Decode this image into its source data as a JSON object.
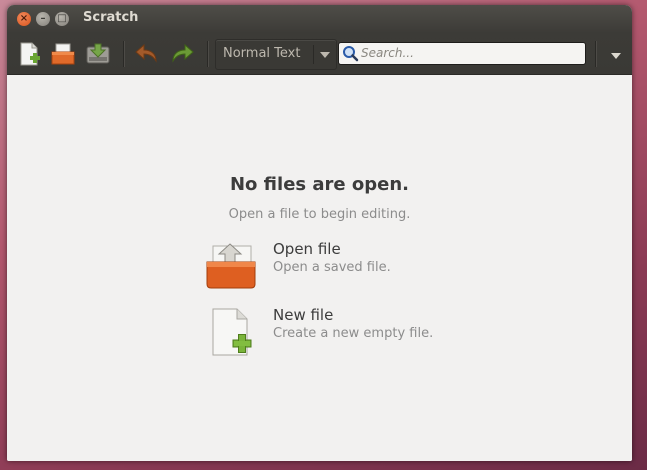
{
  "window": {
    "title": "Scratch",
    "controls": [
      "close",
      "minimize",
      "maximize"
    ]
  },
  "toolbar": {
    "buttons": [
      {
        "icon": "new-document-icon"
      },
      {
        "icon": "open-folder-icon"
      },
      {
        "icon": "save-icon"
      },
      {
        "icon": "undo-icon"
      },
      {
        "icon": "redo-icon"
      }
    ],
    "language_combo": {
      "value": "Normal Text"
    },
    "search": {
      "placeholder": "Search..."
    },
    "menu": {
      "icon": "menu-arrow-icon"
    }
  },
  "welcome": {
    "heading": "No files are open.",
    "subheading": "Open a file to begin editing.",
    "actions": [
      {
        "icon": "open-folder-icon",
        "title": "Open file",
        "description": "Open a saved file."
      },
      {
        "icon": "new-file-icon",
        "title": "New file",
        "description": "Create a new empty file."
      }
    ]
  },
  "colors": {
    "titlebar": "#3c3b37",
    "close_button": "#d8531b",
    "content_bg": "#f2f1f0",
    "desktop": "#b3586e"
  }
}
